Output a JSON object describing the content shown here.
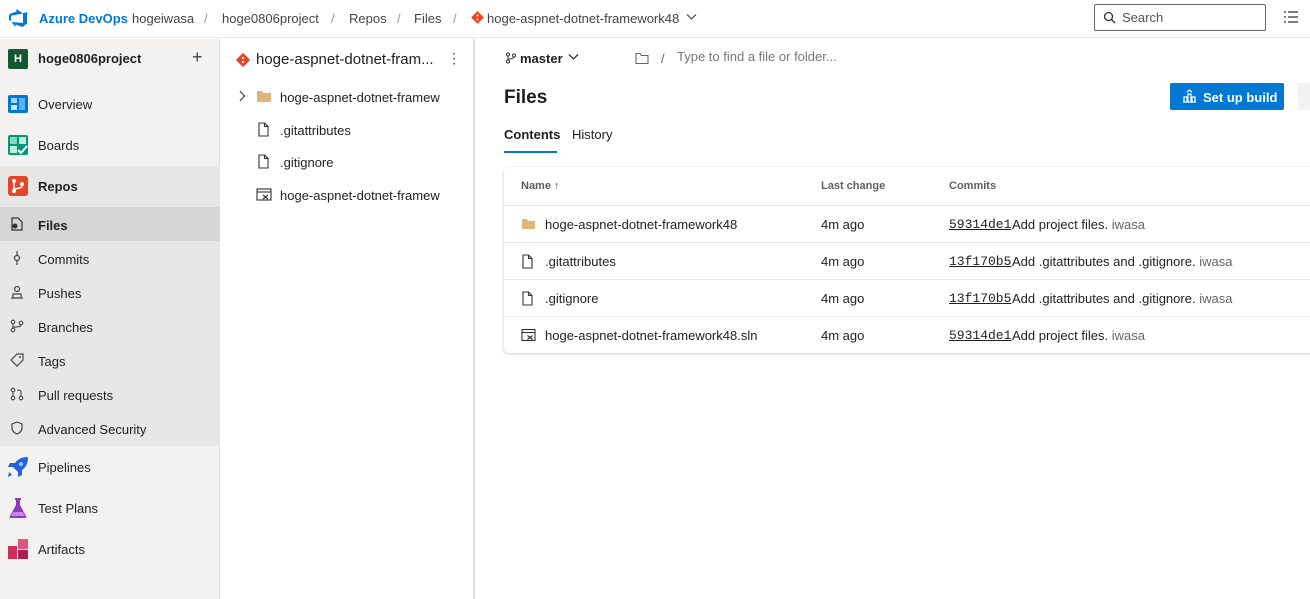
{
  "topbar": {
    "brand": "Azure DevOps",
    "breadcrumbs": [
      "hogeiwasa",
      "hoge0806project",
      "Repos",
      "Files",
      "hoge-aspnet-dotnet-framework48"
    ],
    "separator": "/",
    "search_placeholder": "Search"
  },
  "leftnav": {
    "project_initial": "H",
    "project_name": "hoge0806project",
    "add_symbol": "+",
    "items": [
      {
        "label": "Overview",
        "icon": "overview-icon"
      },
      {
        "label": "Boards",
        "icon": "boards-icon"
      },
      {
        "label": "Repos",
        "icon": "repos-icon"
      },
      {
        "label": "Pipelines",
        "icon": "pipelines-icon"
      },
      {
        "label": "Test Plans",
        "icon": "test-plans-icon"
      },
      {
        "label": "Artifacts",
        "icon": "artifacts-icon"
      }
    ],
    "repo_subitems": [
      {
        "label": "Files",
        "icon": "file-icon"
      },
      {
        "label": "Commits",
        "icon": "commit-icon"
      },
      {
        "label": "Pushes",
        "icon": "push-icon"
      },
      {
        "label": "Branches",
        "icon": "branch-icon"
      },
      {
        "label": "Tags",
        "icon": "tag-icon"
      },
      {
        "label": "Pull requests",
        "icon": "pull-request-icon"
      },
      {
        "label": "Advanced Security",
        "icon": "shield-icon"
      }
    ]
  },
  "tree": {
    "title": "hoge-aspnet-dotnet-fram...",
    "more": "⋮",
    "rows": [
      {
        "label": "hoge-aspnet-dotnet-framew",
        "icon": "folder-icon"
      },
      {
        "label": ".gitattributes",
        "icon": "file-icon"
      },
      {
        "label": ".gitignore",
        "icon": "file-icon"
      },
      {
        "label": "hoge-aspnet-dotnet-framew",
        "icon": "solution-icon"
      }
    ]
  },
  "main": {
    "branch": "master",
    "path_separator": "/",
    "path_placeholder": "Type to find a file or folder...",
    "title": "Files",
    "build_button": "Set up build",
    "tabs": [
      "Contents",
      "History"
    ],
    "columns": {
      "name": "Name",
      "sort": "↑",
      "last_change": "Last change",
      "commits": "Commits"
    },
    "rows": [
      {
        "icon": "folder-icon",
        "name": "hoge-aspnet-dotnet-framework48",
        "change": "4m ago",
        "hash": "59314de1",
        "message": "Add project files.",
        "author": "iwasa"
      },
      {
        "icon": "file-icon",
        "name": ".gitattributes",
        "change": "4m ago",
        "hash": "13f170b5",
        "message": "Add .gitattributes and .gitignore.",
        "author": "iwasa"
      },
      {
        "icon": "file-icon",
        "name": ".gitignore",
        "change": "4m ago",
        "hash": "13f170b5",
        "message": "Add .gitattributes and .gitignore.",
        "author": "iwasa"
      },
      {
        "icon": "solution-icon",
        "name": "hoge-aspnet-dotnet-framework48.sln",
        "change": "4m ago",
        "hash": "59314de1",
        "message": "Add project files.",
        "author": "iwasa"
      }
    ]
  },
  "colors": {
    "accent": "#0078d4",
    "repo_orange": "#e8442b",
    "folder": "#dcb67a"
  }
}
